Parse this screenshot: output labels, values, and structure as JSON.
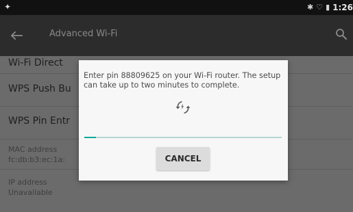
{
  "status_bar": {
    "time": "1:26",
    "left_icon": "signal-bulb-icon",
    "right_icons": [
      "bluetooth-icon",
      "wifi-icon",
      "battery-icon"
    ]
  },
  "app_bar": {
    "title": "Advanced Wi-Fi",
    "back_icon": "back-arrow-icon",
    "search_icon": "search-icon"
  },
  "list_items": [
    {
      "title": "Wi-Fi Direct",
      "secondary": ""
    },
    {
      "title": "WPS Push Bu",
      "secondary": ""
    },
    {
      "title": "WPS Pin Entr",
      "secondary": ""
    },
    {
      "title": "MAC address",
      "secondary": "fc:db:b3:ec:1a:"
    },
    {
      "title": "IP address",
      "secondary": "Unavailable"
    }
  ],
  "dialog": {
    "message": "Enter pin 88809625 on your Wi-Fi router. The setup can take up to two minutes to complete.",
    "progress_fraction": 0.06,
    "cancel_label": "CANCEL"
  },
  "colors": {
    "accent": "#10a89a",
    "app_bar": "#2c2c2c",
    "status_bar": "#111111",
    "list_background": "#6b6b6b",
    "dialog_background": "#f7f7f7"
  }
}
